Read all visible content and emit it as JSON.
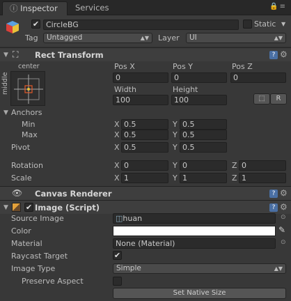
{
  "tabs": [
    {
      "label": "Inspector"
    },
    {
      "label": "Services"
    }
  ],
  "gameobject": {
    "name": "CircleBG",
    "active": true,
    "static_label": "Static",
    "tag_label": "Tag",
    "tag_value": "Untagged",
    "layer_label": "Layer",
    "layer_value": "UI"
  },
  "rect_transform": {
    "title": "Rect Transform",
    "anchor_h": "center",
    "anchor_v": "middle",
    "headers": [
      "Pos X",
      "Pos Y",
      "Pos Z",
      "Width",
      "Height"
    ],
    "pos_x": "0",
    "pos_y": "0",
    "pos_z": "0",
    "width": "100",
    "height": "100",
    "r_button": "R",
    "anchors_label": "Anchors",
    "min_label": "Min",
    "max_label": "Max",
    "min_x": "0.5",
    "min_y": "0.5",
    "max_x": "0.5",
    "max_y": "0.5",
    "pivot_label": "Pivot",
    "pivot_x": "0.5",
    "pivot_y": "0.5",
    "rotation_label": "Rotation",
    "rot_x": "0",
    "rot_y": "0",
    "rot_z": "0",
    "scale_label": "Scale",
    "scale_x": "1",
    "scale_y": "1",
    "scale_z": "1",
    "axis_x": "X",
    "axis_y": "Y",
    "axis_z": "Z"
  },
  "canvas_renderer": {
    "title": "Canvas Renderer"
  },
  "image": {
    "title": "Image (Script)",
    "enabled": true,
    "source_image_label": "Source Image",
    "source_image_value": "huan",
    "color_label": "Color",
    "color_value": "#FFFFFF",
    "material_label": "Material",
    "material_value": "None (Material)",
    "raycast_label": "Raycast Target",
    "raycast_value": true,
    "image_type_label": "Image Type",
    "image_type_value": "Simple",
    "preserve_label": "Preserve Aspect",
    "preserve_value": false,
    "native_size_button": "Set Native Size"
  },
  "help_icon": "?"
}
